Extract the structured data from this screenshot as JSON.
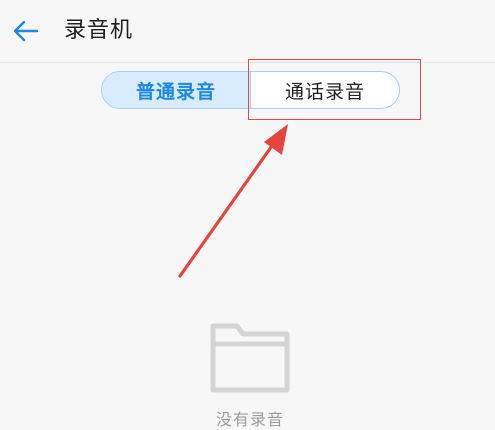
{
  "header": {
    "back_icon": "back-arrow-icon",
    "title": "录音机"
  },
  "tabs": [
    {
      "label": "普通录音",
      "active": true
    },
    {
      "label": "通话录音",
      "active": false
    }
  ],
  "annotation": {
    "highlight_color": "#e04a4a",
    "arrow_color": "#e8443f"
  },
  "empty_state": {
    "icon": "folder-icon",
    "text": "没有录音"
  },
  "colors": {
    "accent": "#1e88e5",
    "tab_active_bg": "#d9ecfd"
  }
}
